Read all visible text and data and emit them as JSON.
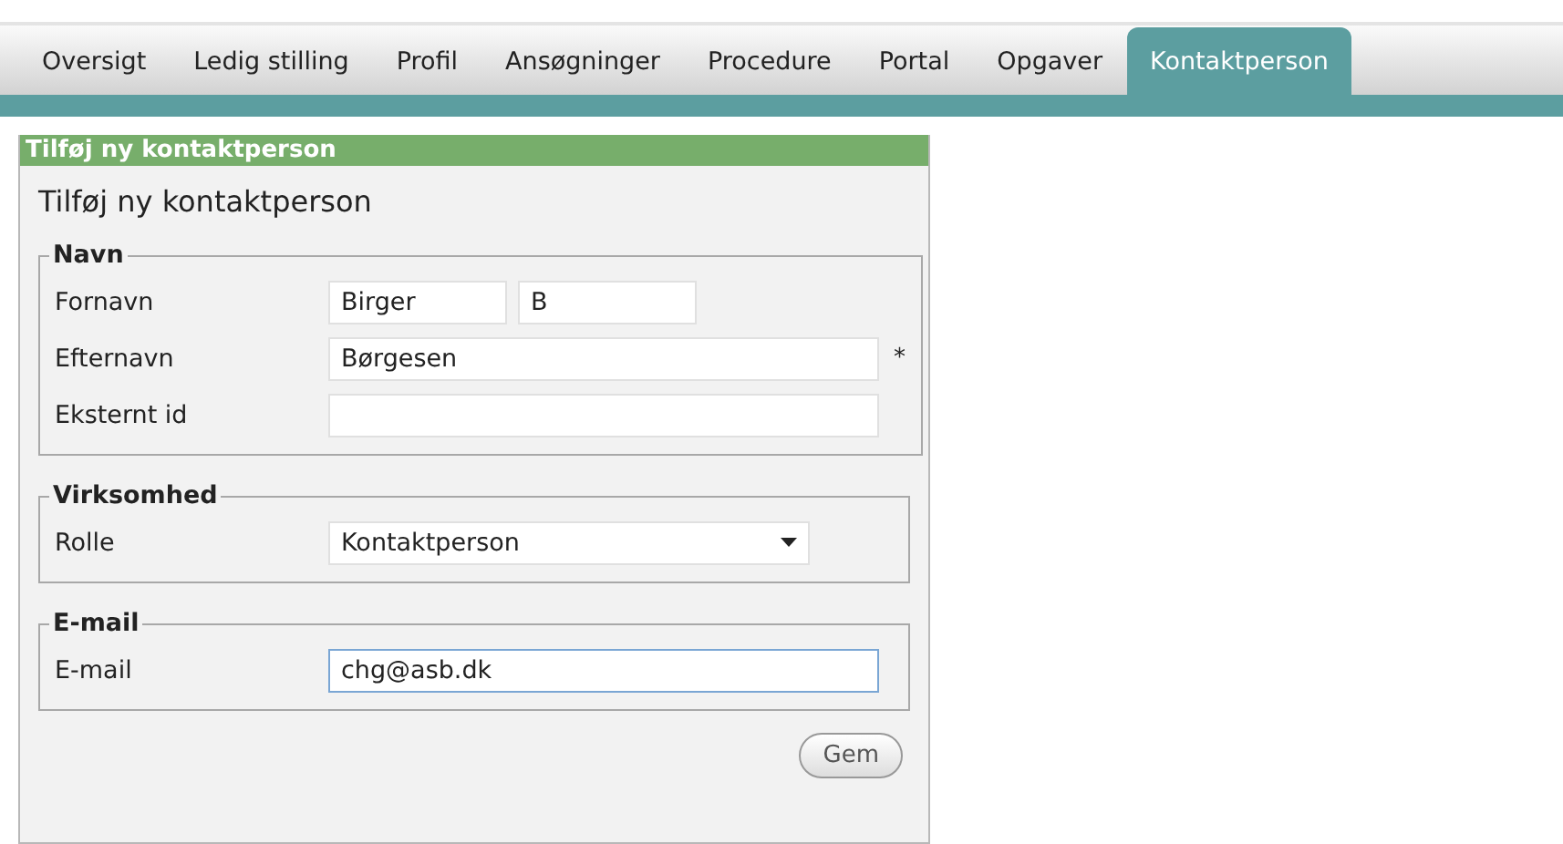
{
  "tabs": [
    {
      "label": "Oversigt",
      "selected": false
    },
    {
      "label": "Ledig stilling",
      "selected": false
    },
    {
      "label": "Profil",
      "selected": false
    },
    {
      "label": "Ansøgninger",
      "selected": false
    },
    {
      "label": "Procedure",
      "selected": false
    },
    {
      "label": "Portal",
      "selected": false
    },
    {
      "label": "Opgaver",
      "selected": false
    },
    {
      "label": "Kontaktperson",
      "selected": true
    }
  ],
  "panel": {
    "header": "Tilføj ny kontaktperson",
    "title": "Tilføj ny kontaktperson",
    "fieldsets": [
      {
        "legend": "Navn",
        "rows": [
          {
            "label": "Fornavn",
            "fields": [
              {
                "kind": "text",
                "value": "Birger",
                "focused": false
              },
              {
                "kind": "text",
                "value": "B",
                "focused": false
              }
            ]
          },
          {
            "label": "Efternavn",
            "required_mark": "*",
            "fields": [
              {
                "kind": "text",
                "value": "Børgesen",
                "focused": false
              }
            ]
          },
          {
            "label": "Eksternt id",
            "fields": [
              {
                "kind": "text",
                "focused": false
              }
            ]
          }
        ]
      },
      {
        "legend": "Virksomhed",
        "rows": [
          {
            "label": "Rolle",
            "fields": [
              {
                "kind": "select",
                "value": "Kontaktperson",
                "focused": false
              }
            ]
          }
        ]
      },
      {
        "legend": "E-mail",
        "rows": [
          {
            "label": "E-mail",
            "fields": [
              {
                "kind": "text",
                "value": "chg@asb.dk",
                "focused": true
              }
            ]
          }
        ]
      }
    ],
    "button": "Gem"
  }
}
